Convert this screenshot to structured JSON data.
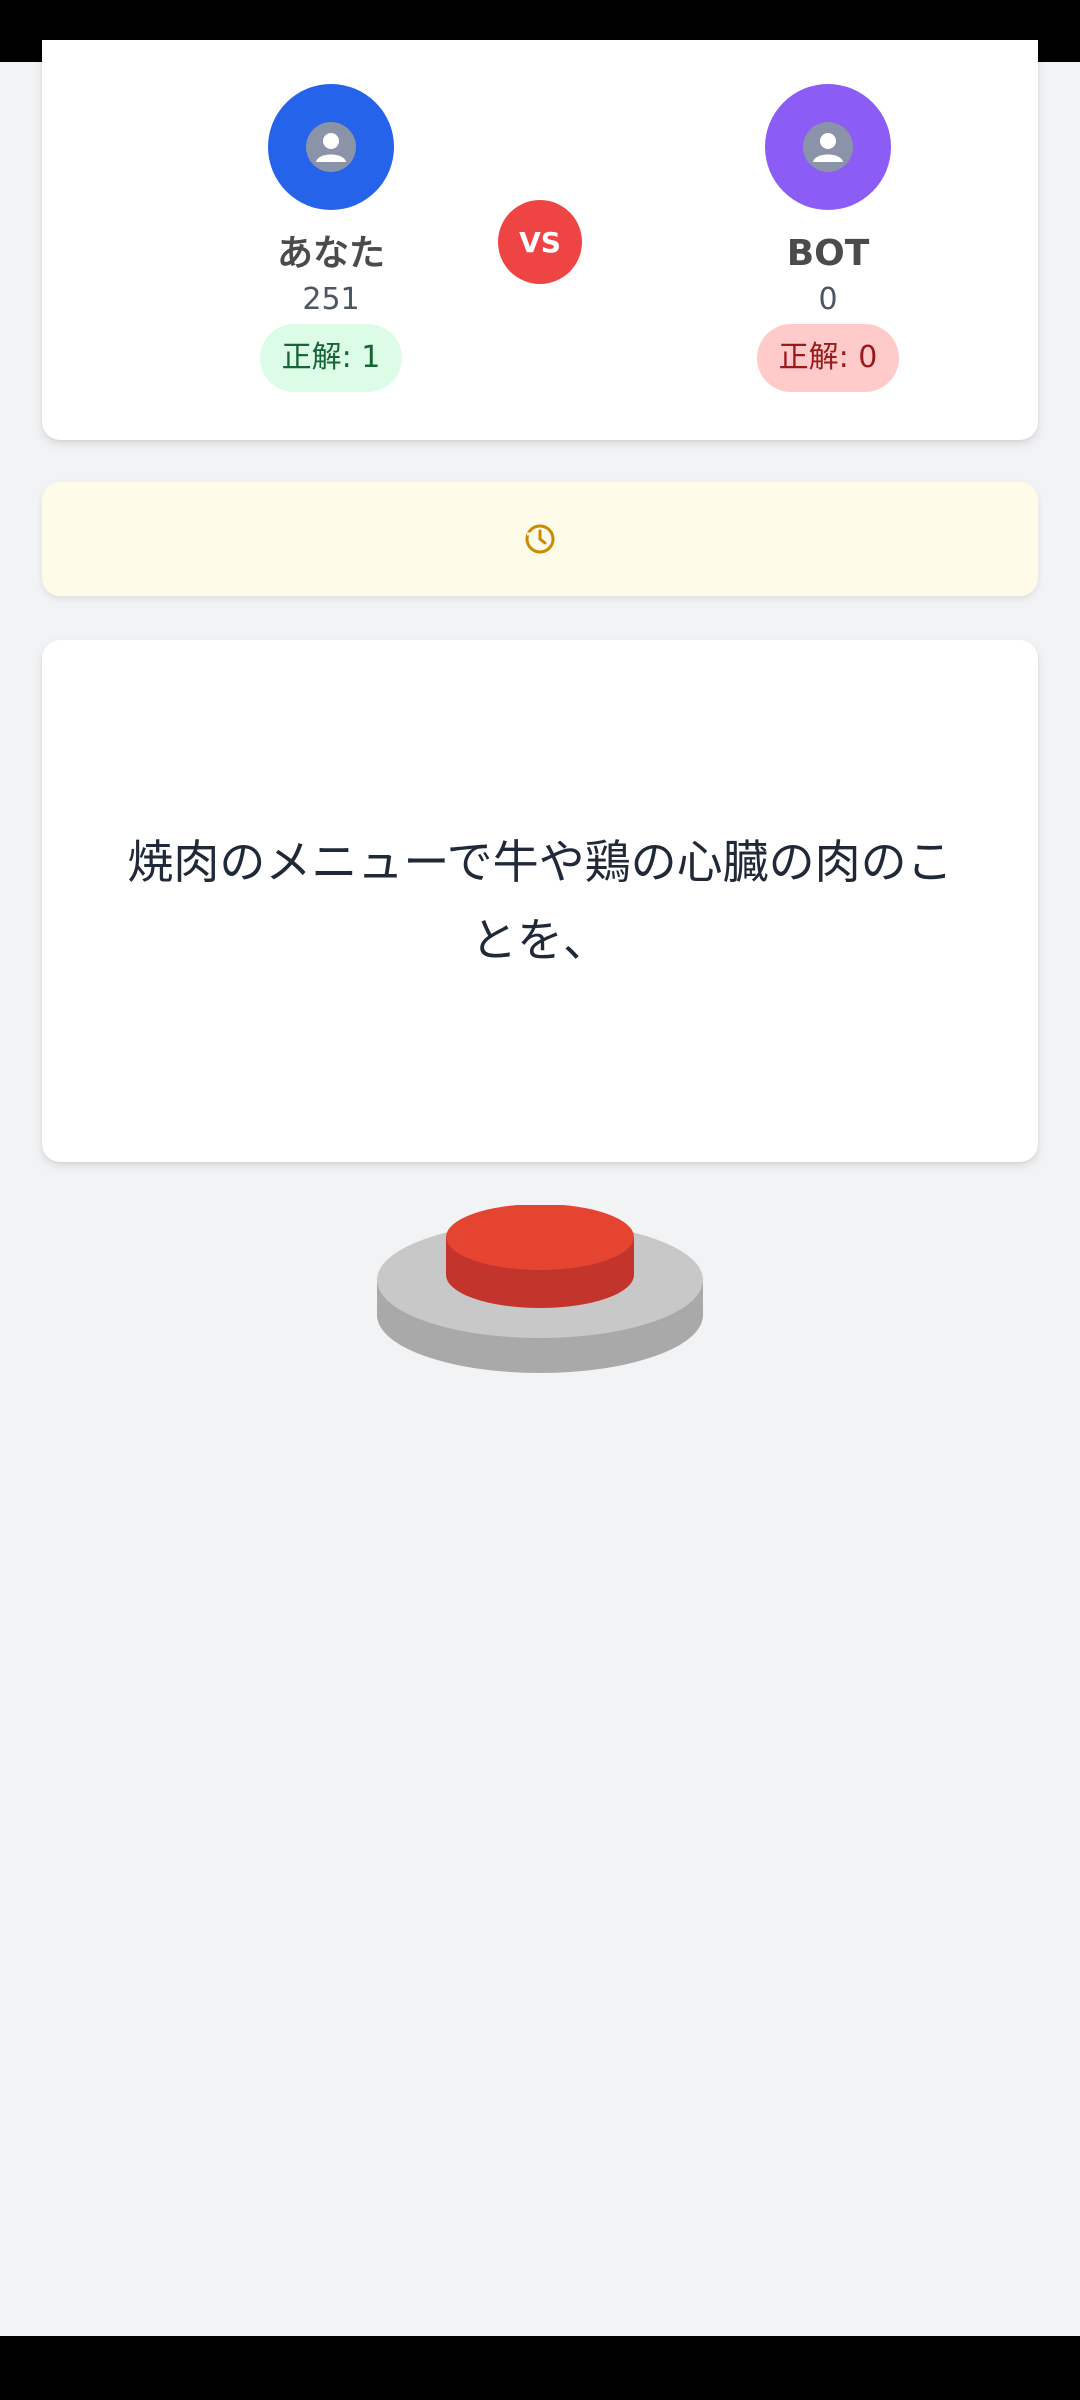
{
  "players": {
    "you": {
      "name": "あなた",
      "score": "251",
      "correct": "正解: 1"
    },
    "bot": {
      "name": "BOT",
      "score": "0",
      "correct": "正解: 0"
    }
  },
  "vs_label": "VS",
  "question": {
    "text": "焼肉のメニューで牛や鶏の心臓の肉のことを、"
  },
  "icons": {
    "player_avatar": "user-icon",
    "timer": "clock-icon",
    "buzzer": "buzzer-button"
  },
  "colors": {
    "you": "#2563eb",
    "bot": "#8b5cf6",
    "vs": "#ef4444",
    "buzzer": "#e53e30",
    "timer_icon": "#ca8a04"
  }
}
